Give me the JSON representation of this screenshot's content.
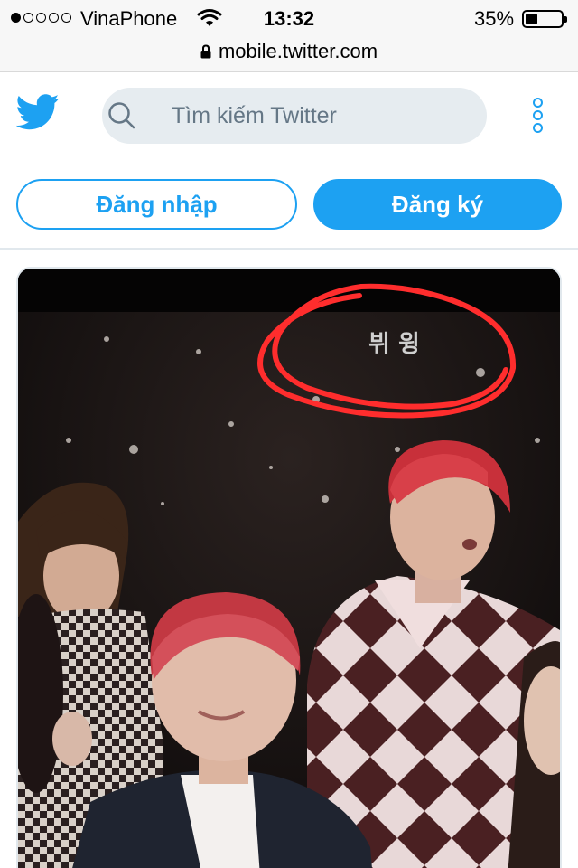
{
  "status_bar": {
    "carrier": "VinaPhone",
    "time": "13:32",
    "battery_percent": "35%",
    "battery_level": 0.35,
    "signal_bars": 1,
    "signal_total": 5
  },
  "browser": {
    "url": "mobile.twitter.com"
  },
  "header": {
    "logo_icon": "twitter-bird-icon",
    "search_placeholder": "Tìm kiếm Twitter",
    "more_icon": "vertical-dots-icon"
  },
  "auth": {
    "login_label": "Đăng nhập",
    "signup_label": "Đăng ký"
  },
  "media": {
    "overlay_text": "뷔 윙"
  },
  "colors": {
    "twitter_blue": "#1da1f2",
    "search_bg": "#e6ecf0",
    "annotation_red": "#ff2d2d"
  }
}
